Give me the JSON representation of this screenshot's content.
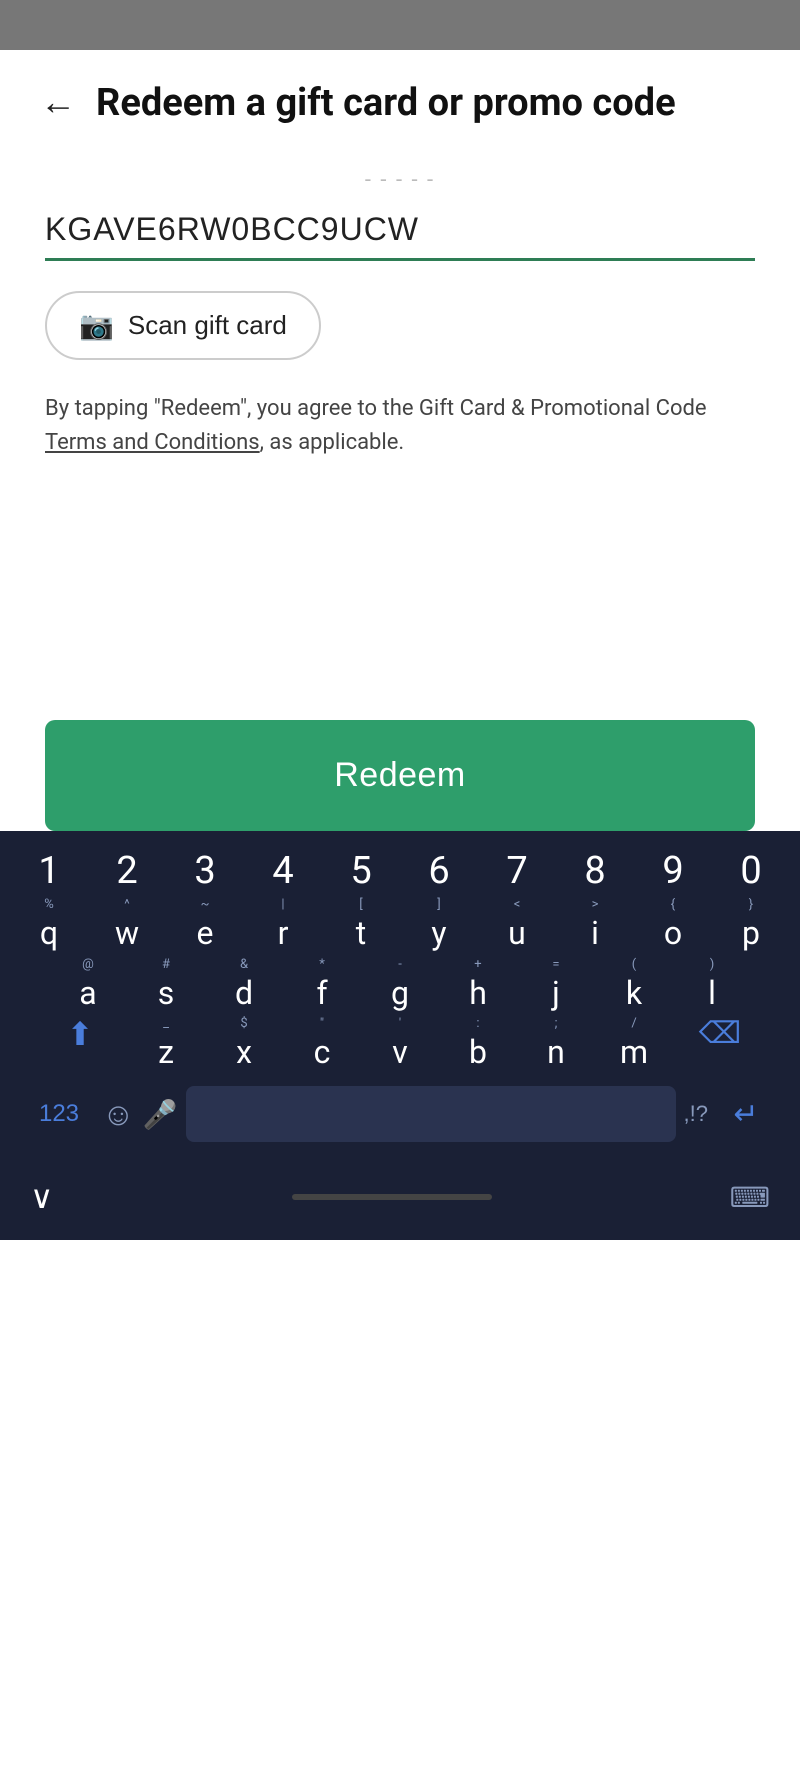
{
  "statusBar": {},
  "header": {
    "backLabel": "←",
    "title": "Redeem a gift card or promo code"
  },
  "content": {
    "fadedHint": "- - - - -",
    "codeInput": {
      "value": "KGAVE6RW0BCC9UCW",
      "placeholder": ""
    },
    "scanButton": {
      "icon": "📷",
      "label": "Scan gift card"
    },
    "terms": {
      "prefix": "By tapping \"Redeem\", you agree to the Gift Card & Promotional Code ",
      "linkText": "Terms and Conditions",
      "suffix": ", as applicable."
    }
  },
  "redeemButton": {
    "label": "Redeem",
    "color": "#2e9e6b"
  },
  "keyboard": {
    "rows": {
      "numbers": [
        "1",
        "2",
        "3",
        "4",
        "5",
        "6",
        "7",
        "8",
        "9",
        "0"
      ],
      "row1": {
        "secondaries": [
          "%",
          "^",
          "~",
          "|",
          "[",
          "]",
          "<",
          ">",
          "{",
          "}"
        ],
        "primaries": [
          "q",
          "w",
          "e",
          "r",
          "t",
          "y",
          "u",
          "i",
          "o",
          "p"
        ]
      },
      "row2": {
        "secondaries": [
          "@",
          "#",
          "&",
          "*",
          "-",
          "+",
          "=",
          "(",
          ")",
          ""
        ],
        "primaries": [
          "a",
          "s",
          "d",
          "f",
          "g",
          "h",
          "j",
          "k",
          "l",
          ""
        ]
      },
      "row3": {
        "secondaries": [
          "_",
          "$",
          "\"",
          "'",
          ":",
          ";",
          " /",
          "",
          "",
          ""
        ],
        "primaries": [
          "z",
          "x",
          "c",
          "v",
          "b",
          "n",
          "m",
          "",
          "",
          ""
        ]
      }
    },
    "specialKeys": {
      "shift": "⬆",
      "backspace": "⌫",
      "123": "123",
      "emoji": "☺",
      "mic": "🎤",
      "comma": ",",
      "punctuation": ",!?",
      "enter": "↵",
      "hideKeyboard": "∨",
      "keyboardIcon": "⌨"
    }
  }
}
